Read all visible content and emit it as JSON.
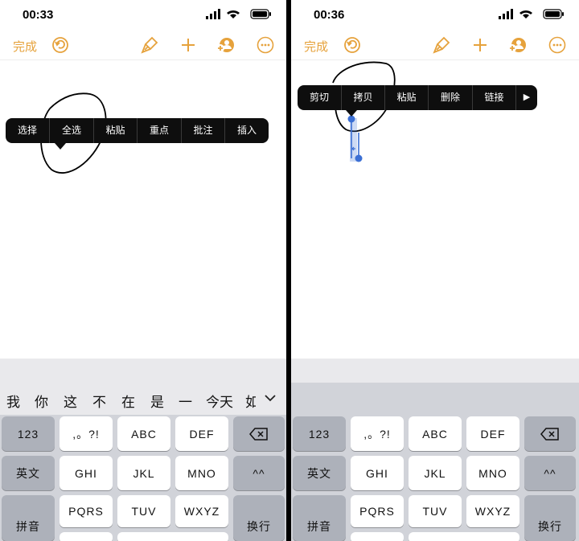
{
  "left": {
    "status_time": "00:33",
    "done_label": "完成",
    "context_menu": [
      "选择",
      "全选",
      "粘贴",
      "重点",
      "批注",
      "插入"
    ],
    "candidates": [
      "我",
      "你",
      "这",
      "不",
      "在",
      "是",
      "一",
      "今天",
      "如"
    ]
  },
  "right": {
    "status_time": "00:36",
    "done_label": "完成",
    "context_menu": [
      "剪切",
      "拷贝",
      "粘贴",
      "删除",
      "链接"
    ],
    "more_arrow": "▶"
  },
  "keyboard": {
    "num_key": "123",
    "punct_key": ",。?!",
    "abc": "ABC",
    "def": "DEF",
    "lang_key": "英文",
    "ghi": "GHI",
    "jkl": "JKL",
    "mno": "MNO",
    "emoji_key": "^^",
    "pinyin_key": "拼音",
    "pqrs": "PQRS",
    "tuv": "TUV",
    "wxyz": "WXYZ",
    "return_key": "换行"
  },
  "colors": {
    "accent": "#e6a23c",
    "menu_bg": "#0e0e0e",
    "selection": "#3b6fd4",
    "keyboard_bg": "#d1d3d9",
    "func_key": "#adb1ba"
  }
}
